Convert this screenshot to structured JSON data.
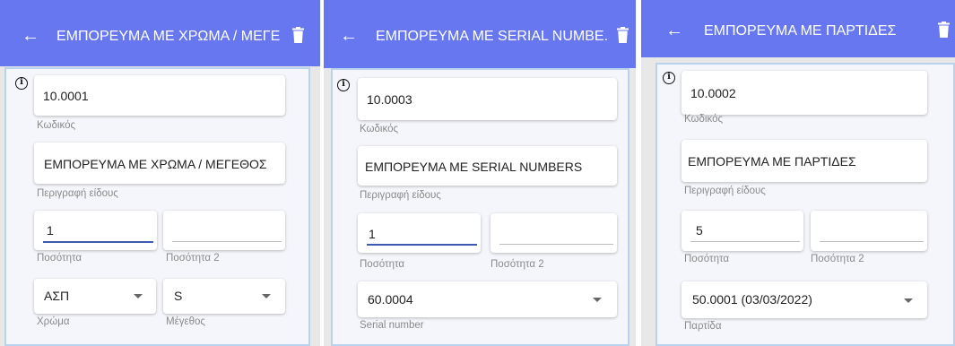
{
  "colors": {
    "appbar": "#6777ef",
    "card_border": "#b9d3ee",
    "active_underline": "#3d5ab3"
  },
  "screens": [
    {
      "title": "ΕΜΠΟΡΕΥΜΑ ΜΕ ΧΡΩΜΑ / ΜΕΓΕ...",
      "back_icon": "arrow-back-icon",
      "delete_icon": "trash-icon",
      "code_value": "10.0001",
      "code_label": "Κωδικός",
      "description_value": "ΕΜΠΟΡΕΥΜΑ ΜΕ ΧΡΩΜΑ / ΜΕΓΕΘΟΣ",
      "description_label": "Περιγραφή είδους",
      "qty_value": "1",
      "qty_label": "Ποσότητα",
      "qty2_value": "",
      "qty2_label": "Ποσότητα 2",
      "color_value": "ΑΣΠ",
      "color_label": "Χρώμα",
      "size_value": "S",
      "size_label": "Μέγεθος"
    },
    {
      "title": "ΕΜΠΟΡΕΥΜΑ ΜΕ SERIAL NUMBE...",
      "back_icon": "arrow-back-icon",
      "delete_icon": "trash-icon",
      "code_value": "10.0003",
      "code_label": "Κωδικός",
      "description_value": "ΕΜΠΟΡΕΥΜΑ ΜΕ SERIAL NUMBERS",
      "description_label": "Περιγραφή είδους",
      "qty_value": "1",
      "qty_label": "Ποσότητα",
      "qty2_value": "",
      "qty2_label": "Ποσότητα 2",
      "serial_value": "60.0004",
      "serial_label": "Serial number"
    },
    {
      "title": "ΕΜΠΟΡΕΥΜΑ ΜΕ ΠΑΡΤΙΔΕΣ",
      "back_icon": "arrow-back-icon",
      "delete_icon": "trash-icon",
      "code_value": "10.0002",
      "code_label": "Κωδικός",
      "description_value": "ΕΜΠΟΡΕΥΜΑ ΜΕ ΠΑΡΤΙΔΕΣ",
      "description_label": "Περιγραφή είδους",
      "qty_value": "5",
      "qty_label": "Ποσότητα",
      "qty2_value": "",
      "qty2_label": "Ποσότητα 2",
      "batch_value": "50.0001 (03/03/2022)",
      "batch_label": "Παρτίδα"
    }
  ]
}
